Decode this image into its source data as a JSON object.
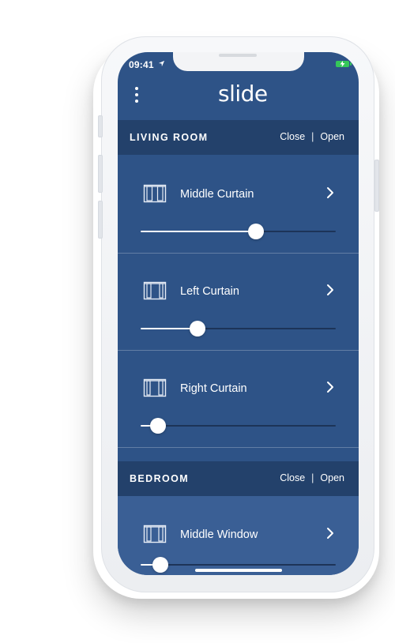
{
  "status_bar": {
    "time": "09:41",
    "location_icon": "location-arrow-icon",
    "battery_icon": "battery-charging-icon",
    "battery_color": "#35c759"
  },
  "header": {
    "menu_icon": "vertical-dots-menu-icon",
    "logo": "slide"
  },
  "colors": {
    "background": "#2e5387",
    "section_header": "#23416b",
    "accent": "#ffffff"
  },
  "rooms": [
    {
      "title": "LIVING ROOM",
      "close_label": "Close",
      "separator": "|",
      "open_label": "Open",
      "devices": [
        {
          "name": "Middle Curtain",
          "icon": "curtain-middle-icon",
          "position_percent": 59
        },
        {
          "name": "Left Curtain",
          "icon": "curtain-left-icon",
          "position_percent": 29
        },
        {
          "name": "Right Curtain",
          "icon": "curtain-right-icon",
          "position_percent": 9
        }
      ]
    },
    {
      "title": "BEDROOM",
      "close_label": "Close",
      "separator": "|",
      "open_label": "Open",
      "devices": [
        {
          "name": "Middle Window",
          "icon": "curtain-middle-icon",
          "position_percent": 10
        }
      ]
    }
  ]
}
